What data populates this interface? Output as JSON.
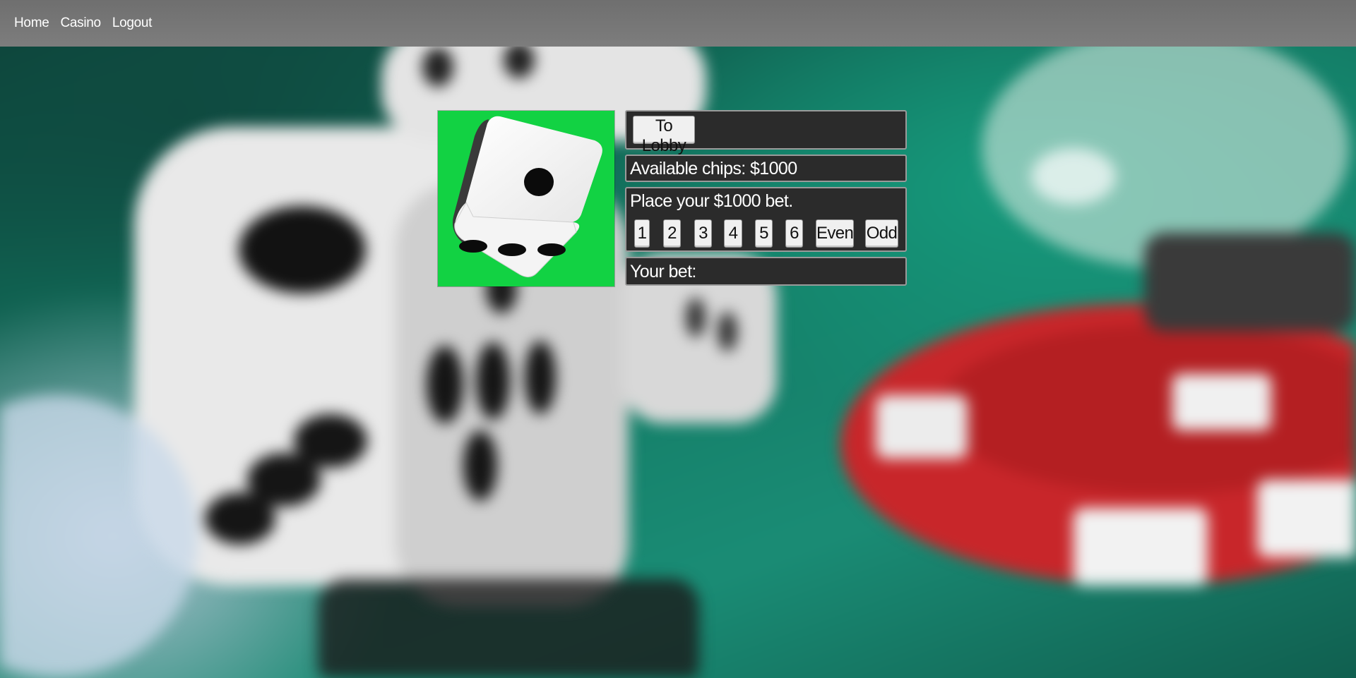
{
  "nav": {
    "home": "Home",
    "casino": "Casino",
    "logout": "Logout"
  },
  "game": {
    "to_lobby": "To Lobby",
    "available_chips": "Available chips: $1000",
    "place_bet": "Place your $1000 bet.",
    "bet_options": [
      "1",
      "2",
      "3",
      "4",
      "5",
      "6",
      "Even",
      "Odd"
    ],
    "your_bet": "Your bet:",
    "dice_face": 3
  },
  "colors": {
    "navbar": "#777777",
    "dice_bg": "#12d243",
    "panel_bg": "#2b2b2b"
  }
}
